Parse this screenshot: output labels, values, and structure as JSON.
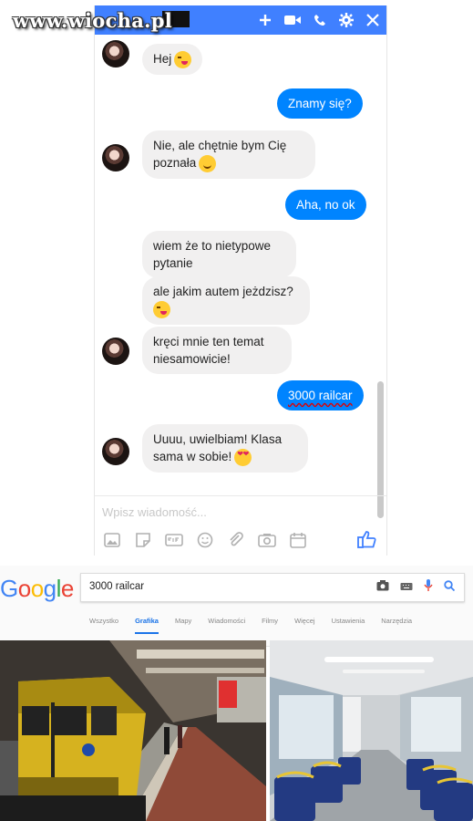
{
  "watermark": "www.wiocha.pl",
  "messenger": {
    "accent": "#4080ff",
    "outgoing_color": "#0084ff",
    "titlebar_icons": [
      "plus-icon",
      "video-icon",
      "phone-icon",
      "gear-icon",
      "close-icon"
    ],
    "messages": [
      {
        "from": "them",
        "text": "Hej",
        "emoji": "wink"
      },
      {
        "from": "me",
        "text": "Znamy się?"
      },
      {
        "from": "them",
        "text": "Nie, ale chętnie bym Cię poznała",
        "emoji": "smile"
      },
      {
        "from": "me",
        "text": "Aha, no ok"
      },
      {
        "from": "them",
        "text": "wiem że to nietypowe pytanie"
      },
      {
        "from": "them",
        "text": "ale jakim autem jeżdzisz?",
        "emoji": "wink"
      },
      {
        "from": "them",
        "text": "kręci mnie ten temat niesamowicie!"
      },
      {
        "from": "me",
        "text": "3000 railcar"
      },
      {
        "from": "them",
        "text": "Uuuu, uwielbiam! Klasa sama w sobie!",
        "emoji": "heart-eyes"
      }
    ],
    "input_placeholder": "Wpisz wiadomość...",
    "toolbar_icons": [
      "image-icon",
      "sticker-icon",
      "gif-icon",
      "emoji-icon",
      "attach-icon",
      "camera-icon",
      "calendar-icon"
    ]
  },
  "google": {
    "logo": "Google",
    "query": "3000 railcar",
    "tabs": [
      "Wszystko",
      "Grafika",
      "Mapy",
      "Wiadomości",
      "Filmy",
      "Więcej",
      "Ustawienia",
      "Narzędzia"
    ],
    "active_tab": "Grafika"
  }
}
